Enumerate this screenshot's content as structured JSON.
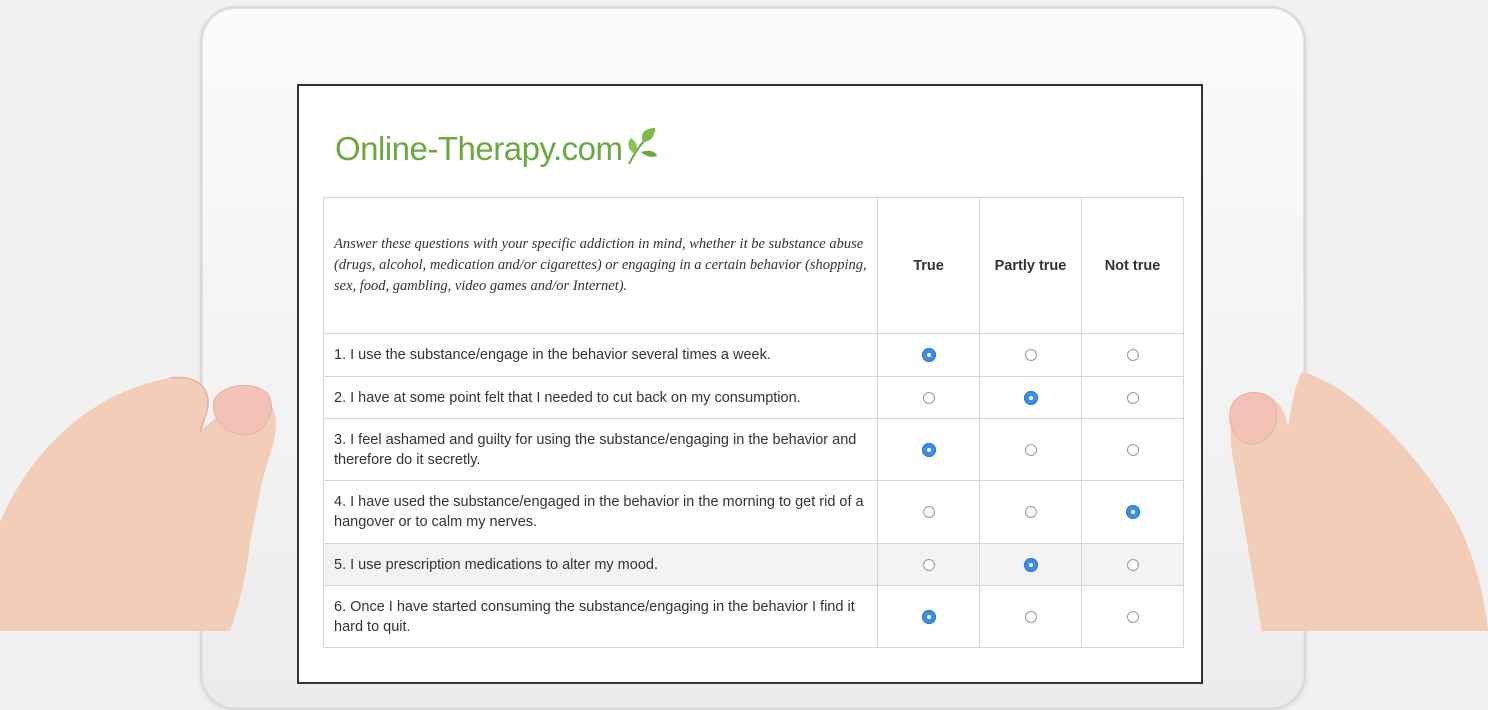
{
  "brand": {
    "logo_text": "Online-Therapy.com",
    "logo_color": "#6aa93f"
  },
  "quiz": {
    "intro": "Answer these questions with your specific addiction in mind, whether it be substance abuse (drugs, alcohol, medication and/or cigarettes) or engaging in a certain behavior (shopping, sex, food, gambling, video games and/or Internet).",
    "columns": [
      "True",
      "Partly true",
      "Not true"
    ],
    "questions": [
      {
        "text": "1. I use the substance/engage in the behavior several times a week.",
        "selected": "True"
      },
      {
        "text": "2. I have at some point felt that I needed to cut back on my consumption.",
        "selected": "Partly true"
      },
      {
        "text": "3. I feel ashamed and guilty for using the substance/engaging in the behavior and therefore do it secretly.",
        "selected": "True"
      },
      {
        "text": "4. I have used the substance/engaged in the behavior in the morning to get rid of a hangover or to calm my nerves.",
        "selected": "Not true"
      },
      {
        "text": "5. I use prescription medications to alter my mood.",
        "selected": "Partly true"
      },
      {
        "text": "6. Once I have started consuming the substance/engaging in the behavior I find it hard to quit.",
        "selected": "True"
      }
    ]
  },
  "colors": {
    "radio_selected": "#3d8ee3",
    "grid_border": "#d6d6d6",
    "highlight_row": "#f3f3f3"
  }
}
